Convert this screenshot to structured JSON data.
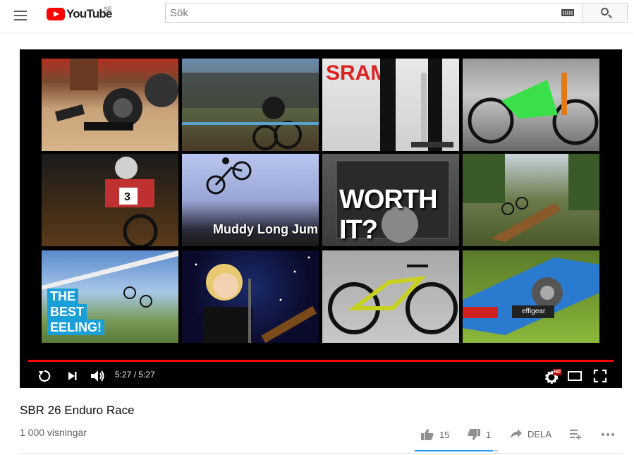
{
  "masthead": {
    "logo_text": "YouTube",
    "country_code": "SE",
    "search_placeholder": "Sök"
  },
  "player": {
    "time_current": "5:27",
    "time_separator": " / ",
    "time_total": "5:27",
    "progress_fraction": 1.0,
    "hd_badge": "HD",
    "endscreen_tiles": [
      {
        "name": "tile-sram-groupset"
      },
      {
        "name": "tile-race-crowd"
      },
      {
        "name": "tile-rockshox-fork"
      },
      {
        "name": "tile-green-bike"
      },
      {
        "name": "tile-downhill-rider"
      },
      {
        "name": "tile-muddy-long-jump",
        "caption": "Muddy Long Jum"
      },
      {
        "name": "tile-worth-it",
        "caption": "WORTH IT?"
      },
      {
        "name": "tile-ramp-jump"
      },
      {
        "name": "tile-best-feeling",
        "caption_lines": [
          "THE",
          "BEST",
          "EELING!"
        ]
      },
      {
        "name": "tile-singer"
      },
      {
        "name": "tile-gravel-bike"
      },
      {
        "name": "tile-blue-bike-effigear",
        "caption": "effigear"
      }
    ]
  },
  "video": {
    "title": "SBR 26 Enduro Race",
    "views": "1 000 visningar",
    "likes": "15",
    "dislikes": "1",
    "share_label": "DELA",
    "like_ratio": 0.94
  },
  "colors": {
    "brand_red": "#ff0000",
    "like_bar": "#2196f3",
    "player_bg": "#000000"
  }
}
